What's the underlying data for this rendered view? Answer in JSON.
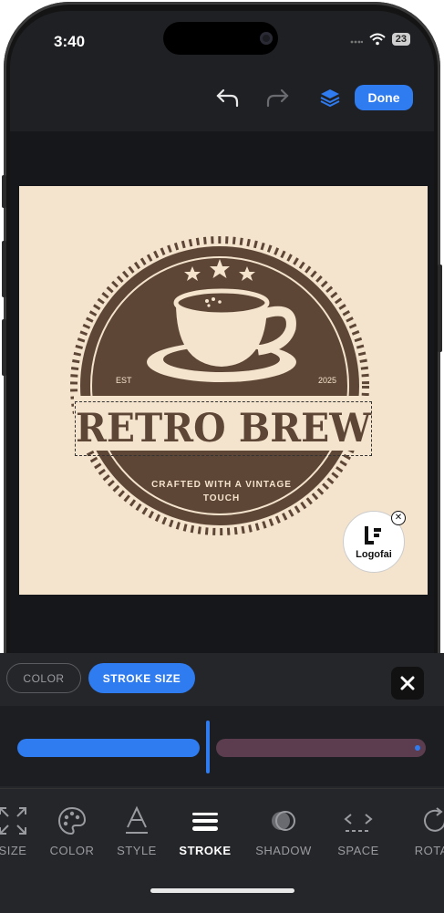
{
  "status_bar": {
    "time": "3:40",
    "battery": "23"
  },
  "header": {
    "done_label": "Done"
  },
  "logo": {
    "brand": "RETRO BREW",
    "est": "EST",
    "year": "2025",
    "tagline_1": "CRAFTED WITH A VINTAGE",
    "tagline_2": "TOUCH"
  },
  "watermark": {
    "label": "Logofai"
  },
  "panel": {
    "tabs": [
      {
        "label": "COLOR",
        "active": false
      },
      {
        "label": "STROKE SIZE",
        "active": true
      }
    ],
    "stroke_slider_value": 0.47
  },
  "tools": [
    {
      "label": "SIZE",
      "icon": "resize-icon"
    },
    {
      "label": "COLOR",
      "icon": "palette-icon"
    },
    {
      "label": "STYLE",
      "icon": "font-style-icon"
    },
    {
      "label": "STROKE",
      "icon": "stroke-lines-icon",
      "active": true
    },
    {
      "label": "SHADOW",
      "icon": "shadow-icon"
    },
    {
      "label": "SPACE",
      "icon": "letter-spacing-icon"
    },
    {
      "label": "ROTAT",
      "icon": "rotate-icon"
    }
  ],
  "colors": {
    "accent": "#2f7bf0",
    "logo_brown": "#5e4636",
    "logo_cream": "#f4e3cd",
    "panel_bg": "#25262a"
  }
}
